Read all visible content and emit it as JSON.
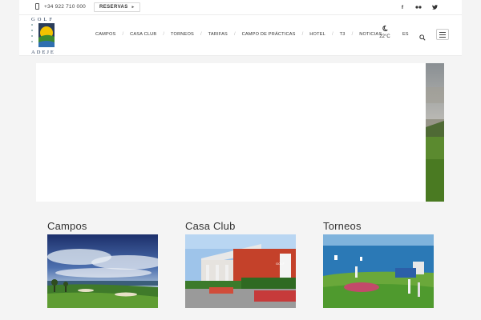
{
  "topbar": {
    "phone": "+34 922 710 000",
    "reservas_label": "RESERVAS",
    "reservas_arrow": "▸",
    "social": [
      {
        "icon": "facebook-icon",
        "label": "f"
      },
      {
        "icon": "flickr-icon",
        "label": "●●"
      },
      {
        "icon": "twitter-icon",
        "label": "🐦"
      }
    ]
  },
  "logo": {
    "top": "GOLF",
    "bottom": "ADEJE"
  },
  "nav": {
    "items": [
      "CAMPOS",
      "CASA CLUB",
      "TORNEOS",
      "TARIFAS",
      "CAMPO DE PRÁCTICAS",
      "HOTEL",
      "T3",
      "NOTICIAS"
    ],
    "separator": "/"
  },
  "weather": {
    "icon": "moon-icon",
    "temp": "22°C"
  },
  "lang": "ES",
  "sections": [
    {
      "title": "Campos",
      "image": "golf-course-landscape"
    },
    {
      "title": "Casa Club",
      "image": "clubhouse-building"
    },
    {
      "title": "Torneos",
      "image": "tournament-green"
    }
  ],
  "colors": {
    "logo_blue": "#2a3d5a",
    "logo_yellow": "#f2c200",
    "logo_green": "#3d8a2e"
  }
}
